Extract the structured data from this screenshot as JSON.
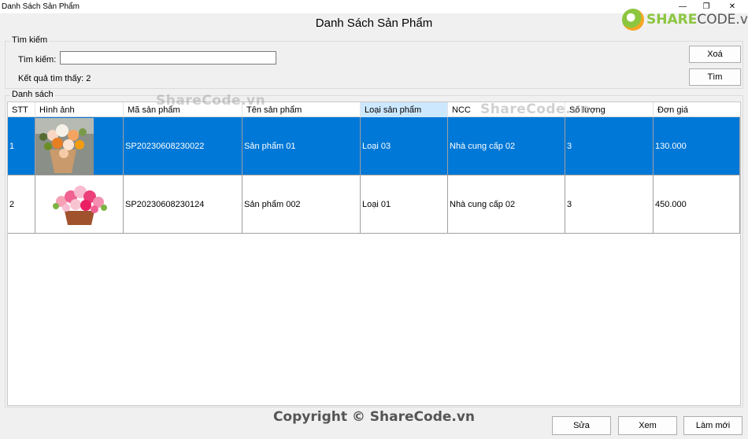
{
  "window": {
    "title": "Danh Sách Sản Phẩm",
    "controls": {
      "minimize": "—",
      "maximize": "❐",
      "close": "✕"
    }
  },
  "header": {
    "heading": "Danh Sách Sản Phẩm"
  },
  "logo": {
    "part1": "SHARE",
    "part2": "CODE.vn"
  },
  "search": {
    "group_label": "Tìm kiếm",
    "field_label": "Tìm kiếm:",
    "value": "",
    "placeholder": "",
    "result_text": "Kết quả tìm thấy: 2",
    "clear_label": "Xoá",
    "search_label": "Tìm"
  },
  "list": {
    "group_label": "Danh sách",
    "columns": [
      "STT",
      "Hình ảnh",
      "Mã sản phẩm",
      "Tên sản phẩm",
      "Loại sản phẩm",
      "NCC",
      "Số lượng",
      "Đơn giá"
    ],
    "active_column": "Loại sản phẩm",
    "rows": [
      {
        "stt": "1",
        "image": "flower-bouquet-orange",
        "code": "SP20230608230022",
        "name": "Sản phẩm 01",
        "category": "Loại 03",
        "supplier": "Nhà cung cấp 02",
        "qty": "3",
        "price": "130.000",
        "selected": true
      },
      {
        "stt": "2",
        "image": "flower-basket-pink",
        "code": "SP20230608230124",
        "name": "Sản phẩm 002",
        "category": "Loại 01",
        "supplier": "Nhà cung cấp 02",
        "qty": "3",
        "price": "450.000",
        "selected": false
      }
    ]
  },
  "watermarks": {
    "text": "ShareCode.vn"
  },
  "footer": {
    "copyright": "Copyright © ShareCode.vn",
    "edit_label": "Sửa",
    "view_label": "Xem",
    "new_label": "Làm mới"
  },
  "colors": {
    "selection": "#0078d7",
    "active_header": "#cce8ff",
    "logo_green": "#8cc63f",
    "logo_orange": "#f5a623"
  }
}
